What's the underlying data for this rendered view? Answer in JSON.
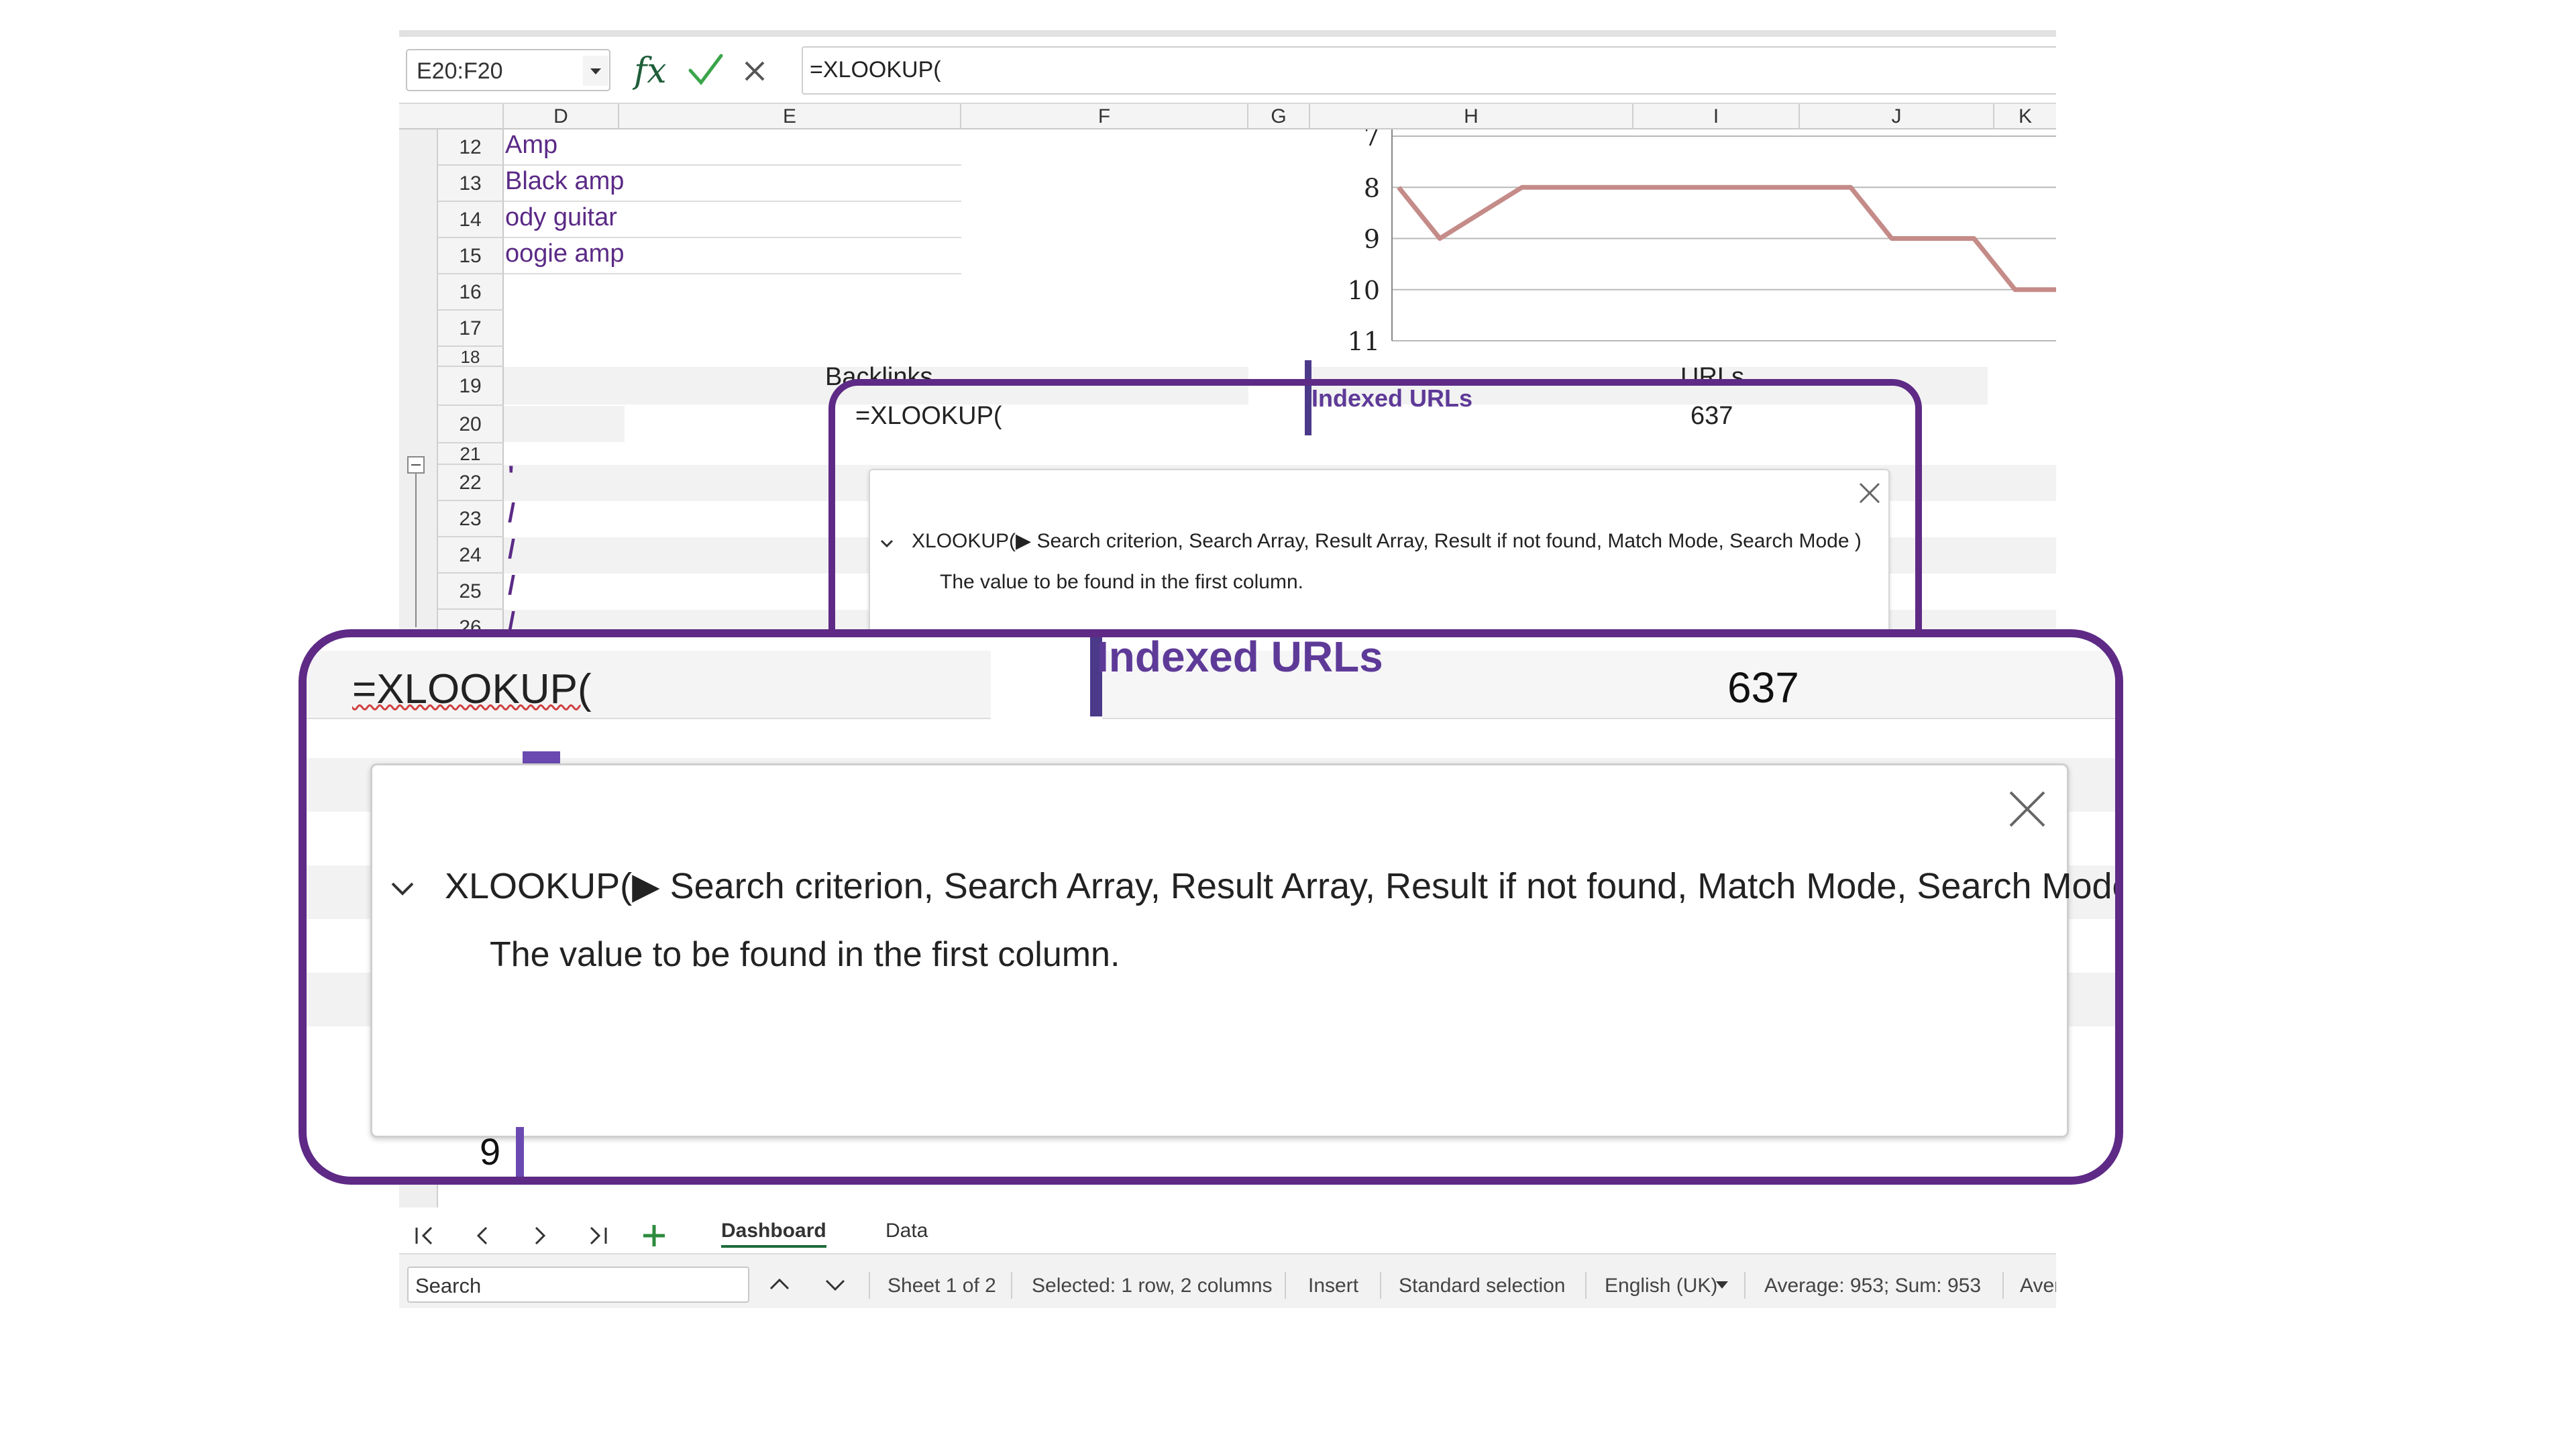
{
  "formula_bar": {
    "name_box": "E20:F20",
    "formula": "=XLOOKUP("
  },
  "columns": [
    "D",
    "E",
    "F",
    "G",
    "H",
    "I",
    "J",
    "K"
  ],
  "outline_levels": "1 2",
  "rows": [
    "12",
    "13",
    "14",
    "15",
    "16",
    "17",
    "18",
    "19",
    "20",
    "21",
    "22",
    "23",
    "24",
    "25",
    "26"
  ],
  "cells": {
    "d12": "Amp",
    "d13": "Black amp",
    "d14": "ody guitar",
    "d15": "oogie amp",
    "e19": "Backlinks",
    "e20": "=XLOOKUP(",
    "h20": "Indexed URLs",
    "i19": "URLs",
    "i20": "637",
    "slash": "/",
    "tick": "'"
  },
  "chart_data": {
    "type": "line",
    "y_ticks": [
      "7",
      "8",
      "9",
      "10",
      "11"
    ],
    "ylim": [
      7,
      11
    ],
    "y_inverted": true,
    "series": [
      {
        "values": [
          8,
          9,
          8.5,
          8,
          8,
          8,
          8,
          8,
          8,
          8,
          8,
          8,
          9,
          9,
          9,
          10,
          10
        ]
      }
    ],
    "line_color": "#c48b88"
  },
  "tooltip": {
    "signature": "XLOOKUP(▶ Search criterion, Search Array, Result Array, Result if not found, Match Mode, Search Mode )",
    "description": "The value to be found in the first column."
  },
  "zoom": {
    "formula": "=XLOOKUP(",
    "indexed": "Indexed URLs",
    "value": "637",
    "row_number": "9",
    "highlight_color": "#5e2a86"
  },
  "sheet_tabs": {
    "tabs": [
      "Dashboard",
      "Data"
    ],
    "active": "Dashboard"
  },
  "status_bar": {
    "search_value": "Search",
    "sheet": "Sheet 1 of 2",
    "selected": "Selected: 1 row, 2 columns",
    "insert_mode": "Insert",
    "selection_mode": "Standard selection",
    "language": "English (UK)",
    "summary": "Average: 953; Sum: 953",
    "overflow": "Aver"
  }
}
